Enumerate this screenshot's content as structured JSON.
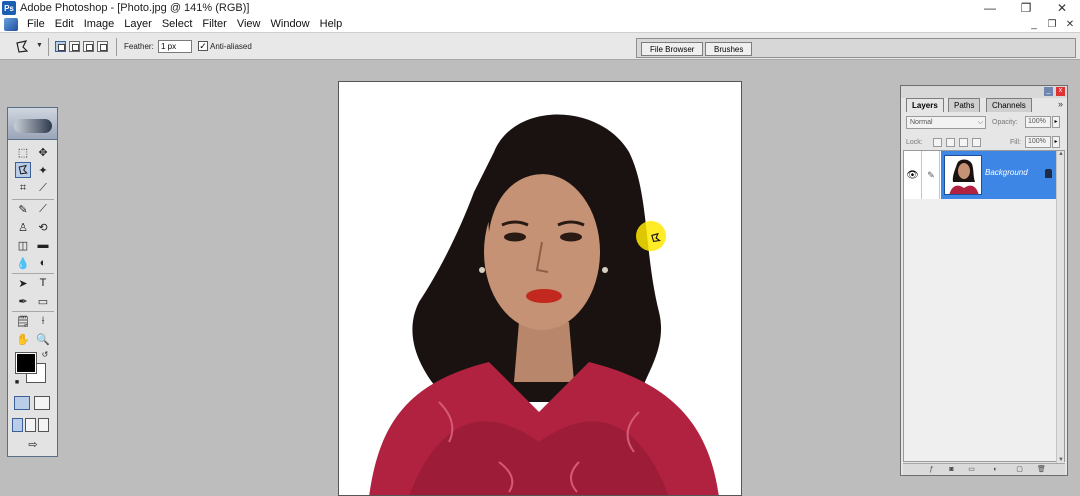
{
  "window": {
    "title": "Adobe Photoshop - [Photo.jpg @ 141% (RGB)]",
    "minimize": "—",
    "restore": "❐",
    "close": "✕"
  },
  "menu": {
    "items": [
      "File",
      "Edit",
      "Image",
      "Layer",
      "Select",
      "Filter",
      "View",
      "Window",
      "Help"
    ],
    "doc_controls": [
      "_",
      "❐",
      "✕"
    ]
  },
  "options_bar": {
    "feather_label": "Feather:",
    "feather_value": "1 px",
    "anti_aliased_label": "Anti-aliased",
    "anti_aliased_checked": "✓"
  },
  "palette_well": {
    "tabs": [
      "File Browser",
      "Brushes"
    ]
  },
  "layers_palette": {
    "tabs": [
      "Layers",
      "Paths",
      "Channels"
    ],
    "menu_button": "»",
    "blend_mode": "Normal",
    "opacity_label": "Opacity:",
    "opacity_value": "100%",
    "lock_label": "Lock:",
    "fill_label": "Fill:",
    "fill_value": "100%",
    "layer_name": "Background"
  },
  "icons": {
    "active_tool": "polygonal-lasso-icon",
    "colors": {
      "foreground": "#000000",
      "background": "#ffffff",
      "layer_selected": "#3d86e6"
    }
  }
}
